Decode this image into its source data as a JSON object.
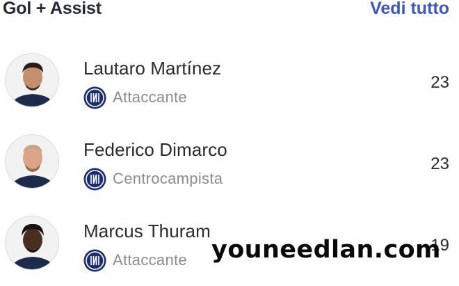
{
  "header": {
    "title": "Gol + Assist",
    "see_all_label": "Vedi tutto",
    "accent_color": "#3d58b8"
  },
  "players": [
    {
      "name": "Lautaro Martínez",
      "position": "Attaccante",
      "value": "23",
      "club_icon": "inter-crest-icon"
    },
    {
      "name": "Federico Dimarco",
      "position": "Centrocampista",
      "value": "23",
      "club_icon": "inter-crest-icon"
    },
    {
      "name": "Marcus Thuram",
      "position": "Attaccante",
      "value": "19",
      "club_icon": "inter-crest-icon"
    }
  ],
  "watermark": "youneedlan.com"
}
